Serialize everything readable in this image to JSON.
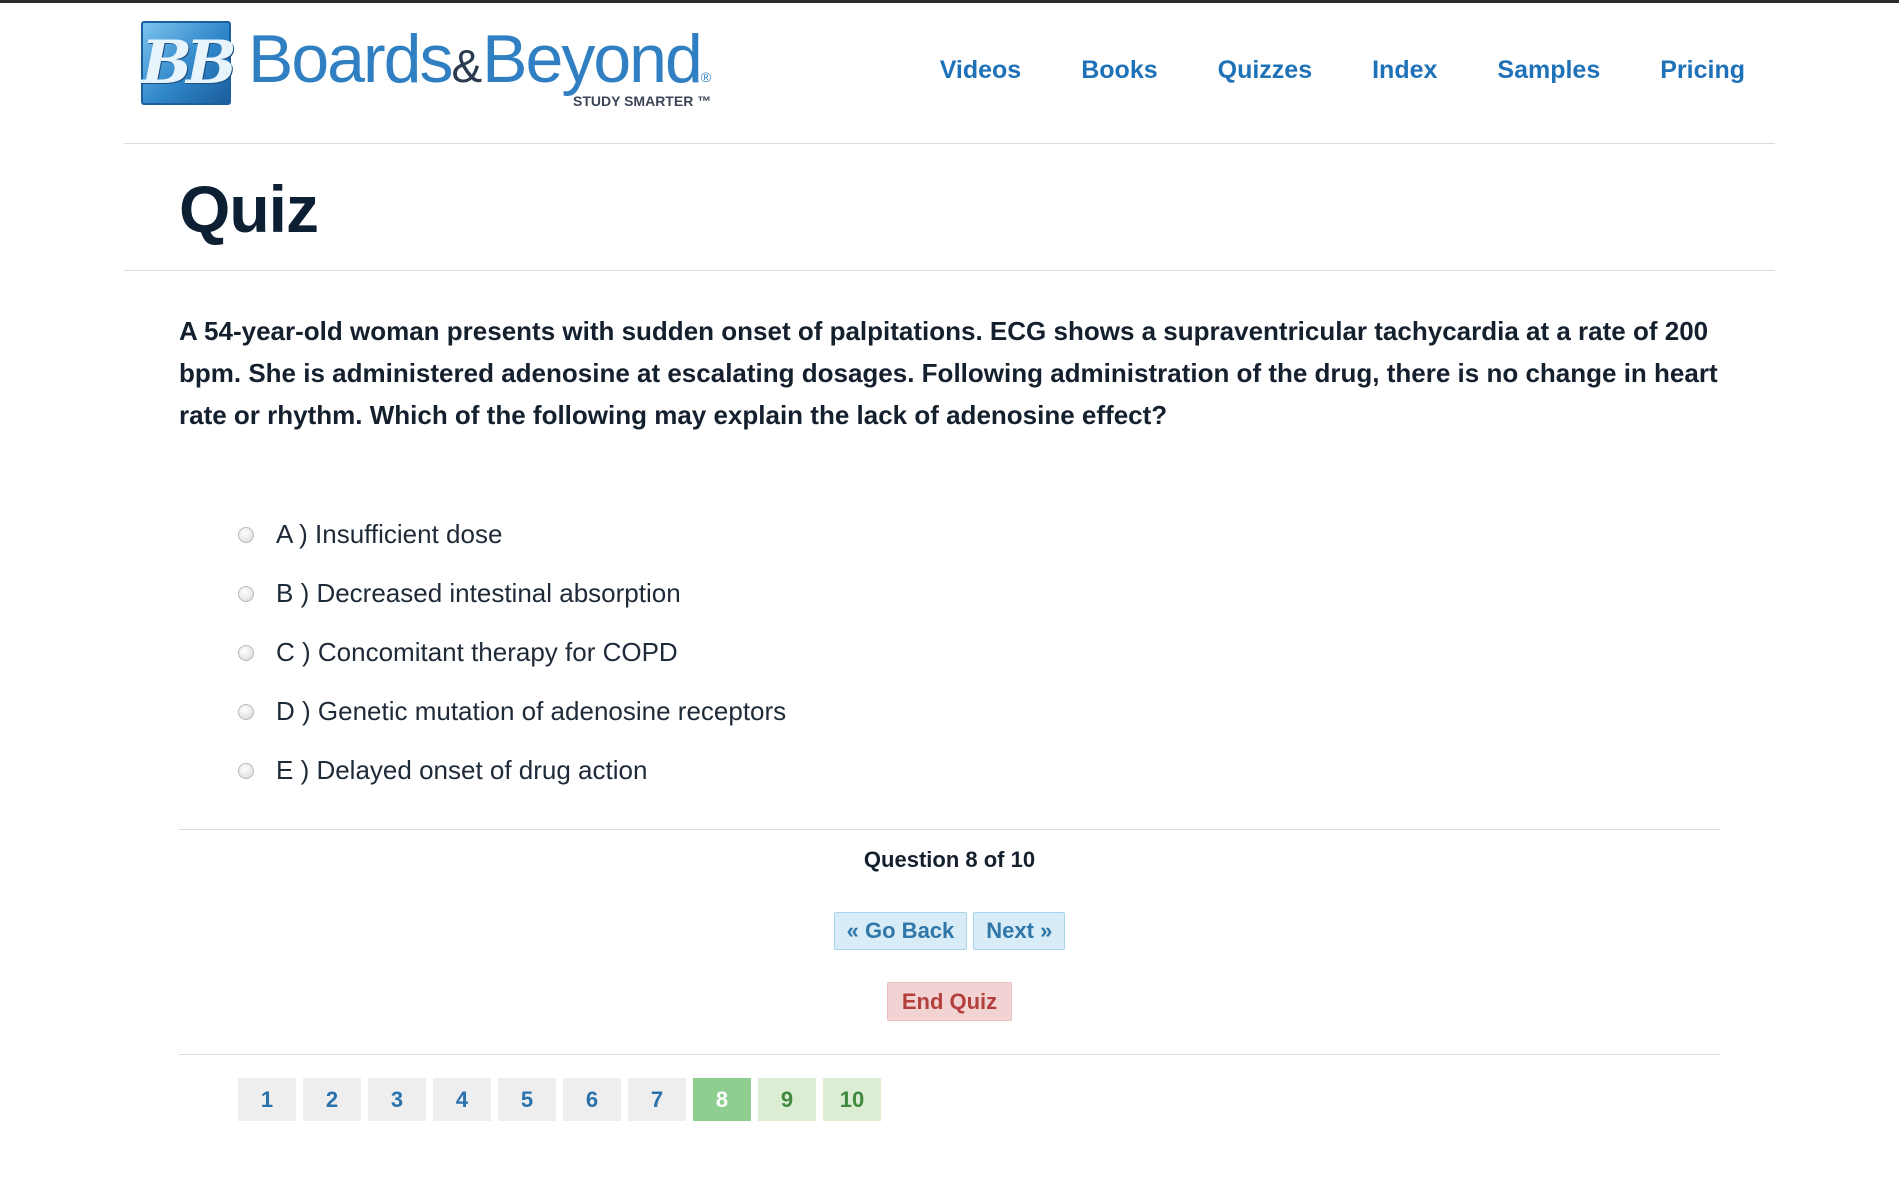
{
  "brand": {
    "logo_mark": "BB",
    "name_part1": "Boards",
    "name_amp": "&",
    "name_part2": "Beyond",
    "registered": "®",
    "tagline": "STUDY SMARTER ™"
  },
  "nav": {
    "items": [
      {
        "label": "Videos"
      },
      {
        "label": "Books"
      },
      {
        "label": "Quizzes"
      },
      {
        "label": "Index"
      },
      {
        "label": "Samples"
      },
      {
        "label": "Pricing"
      }
    ]
  },
  "page": {
    "title": "Quiz"
  },
  "question": {
    "text": "A 54-year-old woman presents with sudden onset of palpitations. ECG shows a supraventricular tachycardia at a rate of 200 bpm.  She is administered adenosine at escalating dosages. Following administration of the drug, there is no change in heart rate or rhythm. Which of the following may explain the lack of adenosine effect?",
    "options": [
      {
        "label": "A ) Insufficient dose",
        "selected": false
      },
      {
        "label": "B ) Decreased intestinal absorption",
        "selected": false
      },
      {
        "label": "C ) Concomitant therapy for COPD",
        "selected": false
      },
      {
        "label": "D ) Genetic mutation of adenosine receptors",
        "selected": false
      },
      {
        "label": "E ) Delayed onset of drug action",
        "selected": false
      }
    ]
  },
  "progress": {
    "counter_text": "Question 8 of 10",
    "current": 8,
    "total": 10
  },
  "controls": {
    "back_label": "« Go Back",
    "next_label": "Next »",
    "end_label": "End Quiz"
  },
  "pagination": {
    "pages": [
      "1",
      "2",
      "3",
      "4",
      "5",
      "6",
      "7",
      "8",
      "9",
      "10"
    ]
  },
  "colors": {
    "brand_blue": "#2f7fc2",
    "nav_blue": "#1f72b8",
    "title_dark": "#0d1f33",
    "current_page_green": "#8fce8f",
    "pending_page_green": "#dcedd4",
    "end_red": "#b4403d"
  }
}
